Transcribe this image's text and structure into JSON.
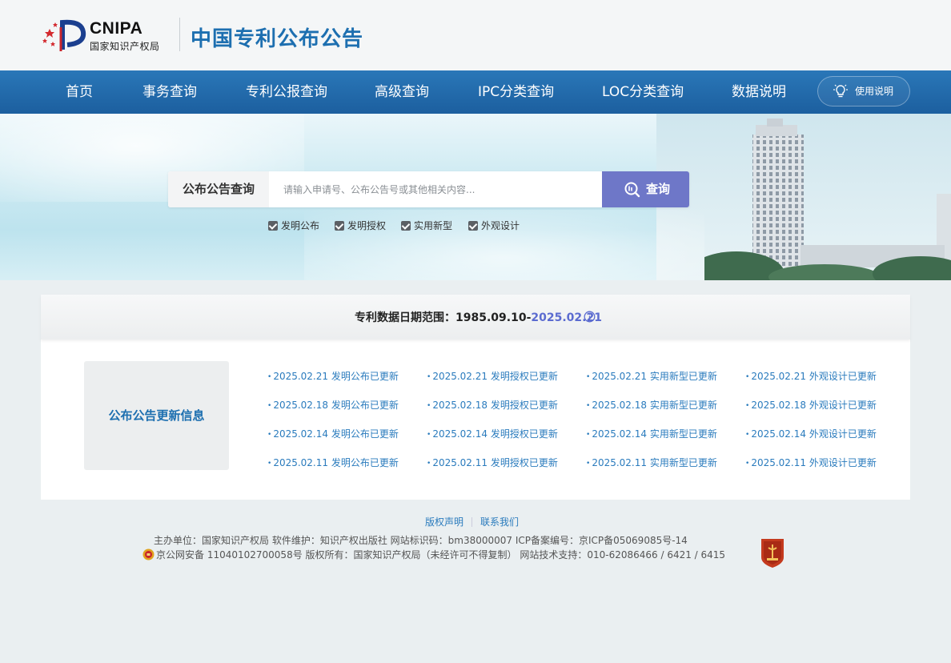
{
  "header": {
    "logo_en": "CNIPA",
    "logo_cn": "国家知识产权局",
    "site_title": "中国专利公布公告"
  },
  "nav": {
    "items": [
      "首页",
      "事务查询",
      "专利公报查询",
      "高级查询",
      "IPC分类查询",
      "LOC分类查询",
      "数据说明"
    ],
    "help_label": "使用说明"
  },
  "search": {
    "tag": "公布公告查询",
    "placeholder": "请输入申请号、公布公告号或其他相关内容...",
    "button": "查询",
    "filters": [
      "发明公布",
      "发明授权",
      "实用新型",
      "外观设计"
    ]
  },
  "panel": {
    "range_label": "专利数据日期范围：",
    "range_start": "1985.09.10-",
    "range_end": "2025.02.21",
    "update_label": "公布公告更新信息",
    "updates": [
      [
        "2025.02.21 发明公布已更新",
        "2025.02.21 发明授权已更新",
        "2025.02.21 实用新型已更新",
        "2025.02.21 外观设计已更新"
      ],
      [
        "2025.02.18 发明公布已更新",
        "2025.02.18 发明授权已更新",
        "2025.02.18 实用新型已更新",
        "2025.02.18 外观设计已更新"
      ],
      [
        "2025.02.14 发明公布已更新",
        "2025.02.14 发明授权已更新",
        "2025.02.14 实用新型已更新",
        "2025.02.14 外观设计已更新"
      ],
      [
        "2025.02.11 发明公布已更新",
        "2025.02.11 发明授权已更新",
        "2025.02.11 实用新型已更新",
        "2025.02.11 外观设计已更新"
      ]
    ]
  },
  "footer": {
    "copyright_link": "版权声明",
    "contact_link": "联系我们",
    "line1": "主办单位：国家知识产权局   软件维护：知识产权出版社   网站标识码：bm38000007   ICP备案编号：京ICP备05069085号-14",
    "line2": "京公网安备 11040102700058号  版权所有：国家知识产权局（未经许可不得复制）   网站技术支持：010-62086466 / 6421 / 6415"
  },
  "colors": {
    "nav_blue": "#1f66a8",
    "title_blue": "#1d6fb0",
    "search_button": "#6e77c8",
    "link_blue": "#2a7bbd"
  },
  "icons": [
    "lightbulb-icon",
    "search-icon",
    "info-icon",
    "police-emblem-icon",
    "gov-badge-icon"
  ]
}
